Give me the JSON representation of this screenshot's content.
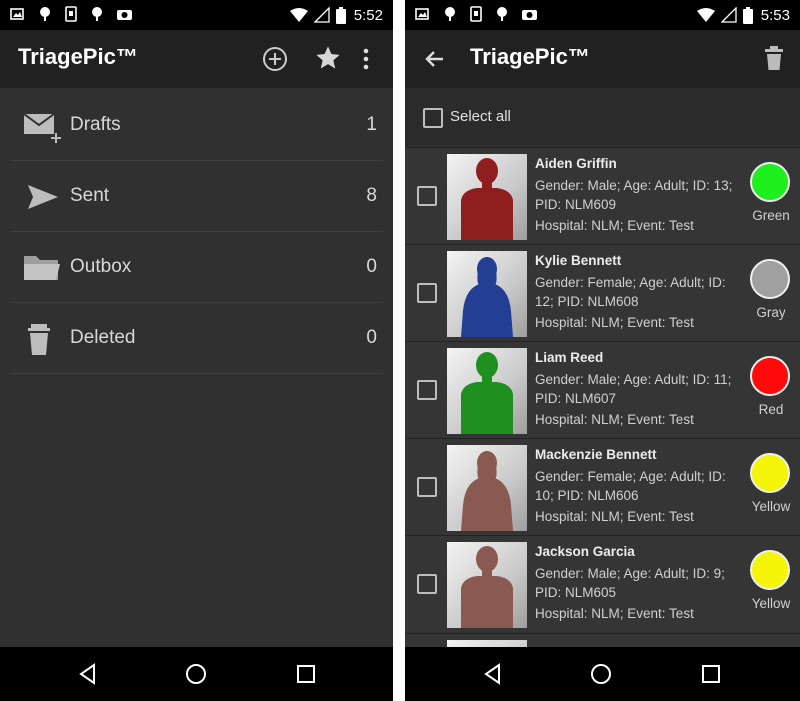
{
  "left": {
    "status": {
      "time": "5:52"
    },
    "app_title": "TriagePic™",
    "actions": [
      "add-icon",
      "star-icon",
      "overflow-menu-icon"
    ],
    "folders": [
      {
        "label": "Drafts",
        "count": "1",
        "icon": "drafts-icon"
      },
      {
        "label": "Sent",
        "count": "8",
        "icon": "send-icon"
      },
      {
        "label": "Outbox",
        "count": "0",
        "icon": "folder-icon"
      },
      {
        "label": "Deleted",
        "count": "0",
        "icon": "trash-icon"
      }
    ]
  },
  "right": {
    "status": {
      "time": "5:53"
    },
    "app_title": "TriagePic™",
    "select_all_label": "Select all",
    "patients": [
      {
        "name": "Aiden Griffin",
        "details": "Gender: Male; Age: Adult; ID: 13; PID: NLM609",
        "hospital": "Hospital: NLM; Event: Test",
        "triage": "Green",
        "triage_color": "#1ef01e",
        "silhouette": "male",
        "silhouette_color": "#8f1f1f"
      },
      {
        "name": "Kylie Bennett",
        "details": "Gender: Female; Age: Adult; ID: 12; PID: NLM608",
        "hospital": "Hospital: NLM; Event: Test",
        "triage": "Gray",
        "triage_color": "#a0a0a0",
        "silhouette": "female",
        "silhouette_color": "#233f93"
      },
      {
        "name": "Liam Reed",
        "details": "Gender: Male; Age: Adult; ID: 11; PID: NLM607",
        "hospital": "Hospital: NLM; Event: Test",
        "triage": "Red",
        "triage_color": "#ff0a0a",
        "silhouette": "male",
        "silhouette_color": "#1f8f1f"
      },
      {
        "name": "Mackenzie Bennett",
        "details": "Gender: Female; Age: Adult; ID: 10; PID: NLM606",
        "hospital": "Hospital: NLM; Event: Test",
        "triage": "Yellow",
        "triage_color": "#f5f50a",
        "silhouette": "female",
        "silhouette_color": "#8a5a52"
      },
      {
        "name": "Jackson Garcia",
        "details": "Gender: Male; Age: Adult; ID: 9; PID: NLM605",
        "hospital": "Hospital: NLM; Event: Test",
        "triage": "Yellow",
        "triage_color": "#f5f50a",
        "silhouette": "male",
        "silhouette_color": "#8a5a52"
      }
    ]
  }
}
